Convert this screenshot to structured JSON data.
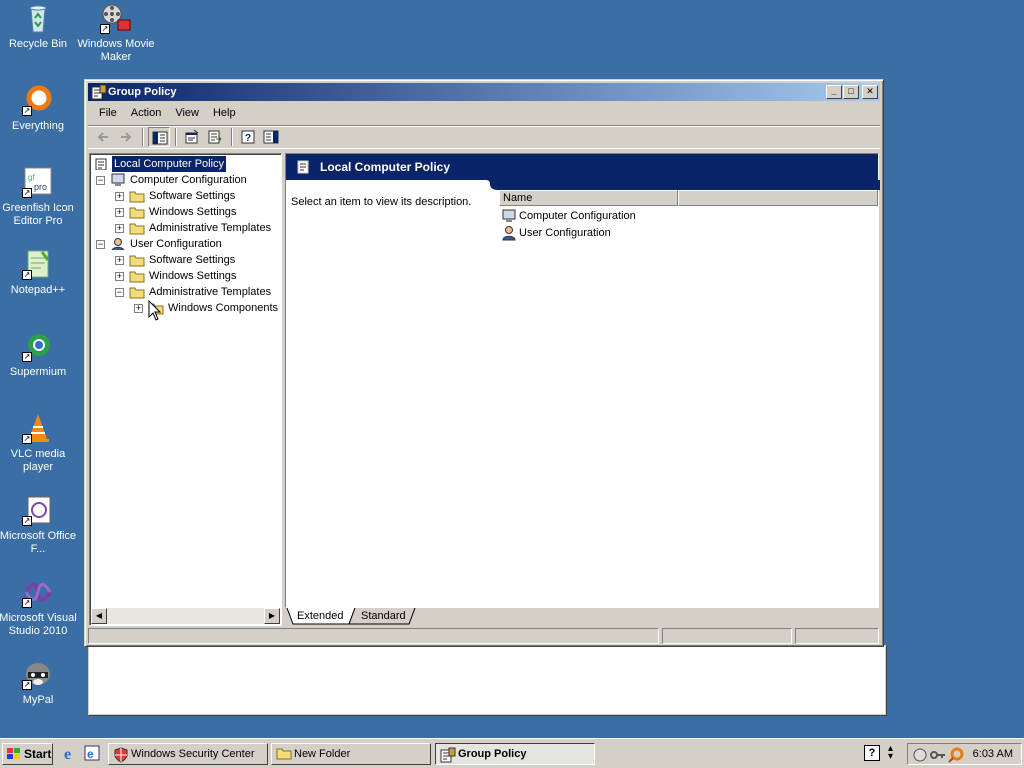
{
  "desktop": {
    "icons": [
      {
        "label": "Recycle Bin"
      },
      {
        "label": "Windows Movie Maker"
      },
      {
        "label": "Everything"
      },
      {
        "label": "Greenfish Icon Editor Pro"
      },
      {
        "label": "Notepad++"
      },
      {
        "label": "Supermium"
      },
      {
        "label": "VLC media player"
      },
      {
        "label": "Microsoft Office F..."
      },
      {
        "label": "Microsoft Visual Studio 2010"
      },
      {
        "label": "MyPal"
      }
    ]
  },
  "window": {
    "title": "Group Policy",
    "menu": [
      "File",
      "Action",
      "View",
      "Help"
    ],
    "tree": {
      "root": "Local Computer Policy",
      "computer_config": "Computer Configuration",
      "cc_software": "Software Settings",
      "cc_windows": "Windows Settings",
      "cc_admin": "Administrative Templates",
      "user_config": "User Configuration",
      "uc_software": "Software Settings",
      "uc_windows": "Windows Settings",
      "uc_admin": "Administrative Templates",
      "uc_components": "Windows Components"
    },
    "right": {
      "header": "Local Computer Policy",
      "description": "Select an item to view its description.",
      "column_name": "Name",
      "items": [
        "Computer Configuration",
        "User Configuration"
      ]
    },
    "tabs": {
      "extended": "Extended",
      "standard": "Standard"
    }
  },
  "taskbar": {
    "start": "Start",
    "tasks": [
      "Windows Security Center",
      "New Folder",
      "Group Policy"
    ],
    "clock": "6:03 AM",
    "help_glyph": "?"
  },
  "colors": {
    "desktop": "#3a6ea5",
    "title_active": "#0a246a",
    "face": "#d4d0c8"
  }
}
